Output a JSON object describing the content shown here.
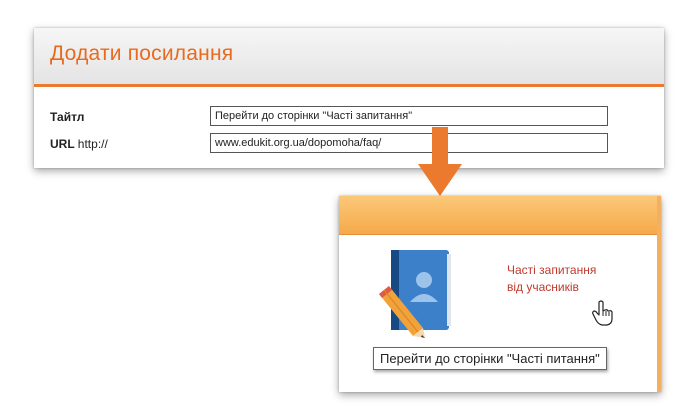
{
  "dialog": {
    "title": "Додати посилання",
    "fields": [
      {
        "label": "Тайтл",
        "label_suffix": "",
        "value": "Перейти до сторінки \"Часті запитання\""
      },
      {
        "label": "URL",
        "label_suffix": "http://",
        "value": "www.edukit.org.ua/dopomoha/faq/"
      }
    ]
  },
  "widget": {
    "link_line1": "Часті запитання",
    "link_line2": "від учасників",
    "icons": [
      "book-icon",
      "pencil-icon",
      "hand-cursor-icon"
    ]
  },
  "tooltip": {
    "text": "Перейти до сторінки \"Часті питання\""
  },
  "colors": {
    "accent": "#ec7a2e",
    "header_orange": "#f6a94a",
    "link_red": "#c0392b",
    "book_blue": "#2f6fb3"
  }
}
